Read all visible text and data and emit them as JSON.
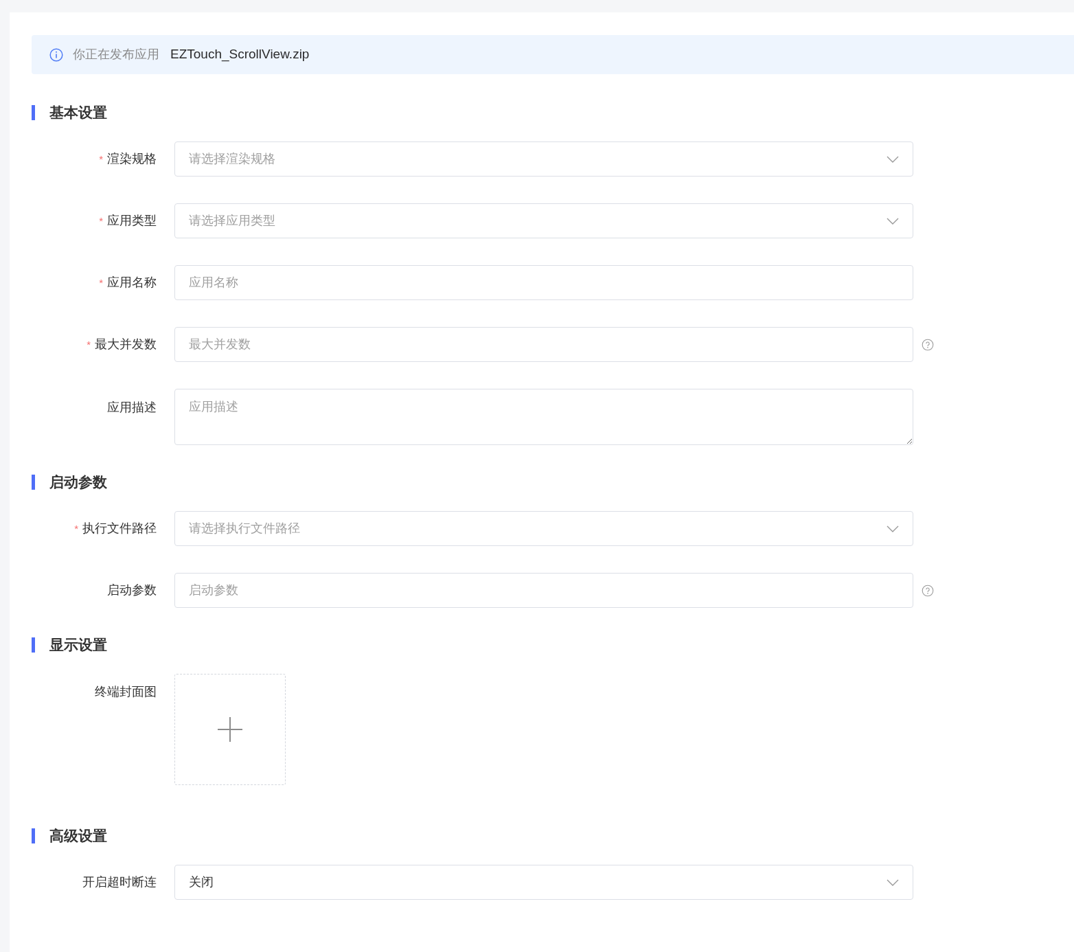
{
  "notice": {
    "text": "你正在发布应用",
    "filename": "EZTouch_ScrollView.zip"
  },
  "sections": [
    {
      "title": "基本设置",
      "fields": [
        {
          "kind": "select",
          "label": "渲染规格",
          "required_mark": "*",
          "placeholder": "请选择渲染规格"
        },
        {
          "kind": "select",
          "label": "应用类型",
          "required_mark": "*",
          "placeholder": "请选择应用类型"
        },
        {
          "kind": "input",
          "label": "应用名称",
          "required_mark": "*",
          "placeholder": "应用名称"
        },
        {
          "kind": "input",
          "label": "最大并发数",
          "required_mark": "*",
          "placeholder": "最大并发数",
          "help": true
        },
        {
          "kind": "textarea",
          "label": "应用描述",
          "placeholder": "应用描述"
        }
      ]
    },
    {
      "title": "启动参数",
      "fields": [
        {
          "kind": "select",
          "label": "执行文件路径",
          "required_mark": "*",
          "placeholder": "请选择执行文件路径"
        },
        {
          "kind": "input",
          "label": "启动参数",
          "placeholder": "启动参数",
          "help": true
        }
      ]
    },
    {
      "title": "显示设置",
      "fields": [
        {
          "kind": "upload",
          "label": "终端封面图"
        }
      ]
    },
    {
      "title": "高级设置",
      "fields": [
        {
          "kind": "select",
          "label": "开启超时断连",
          "value": "关闭"
        }
      ]
    }
  ]
}
